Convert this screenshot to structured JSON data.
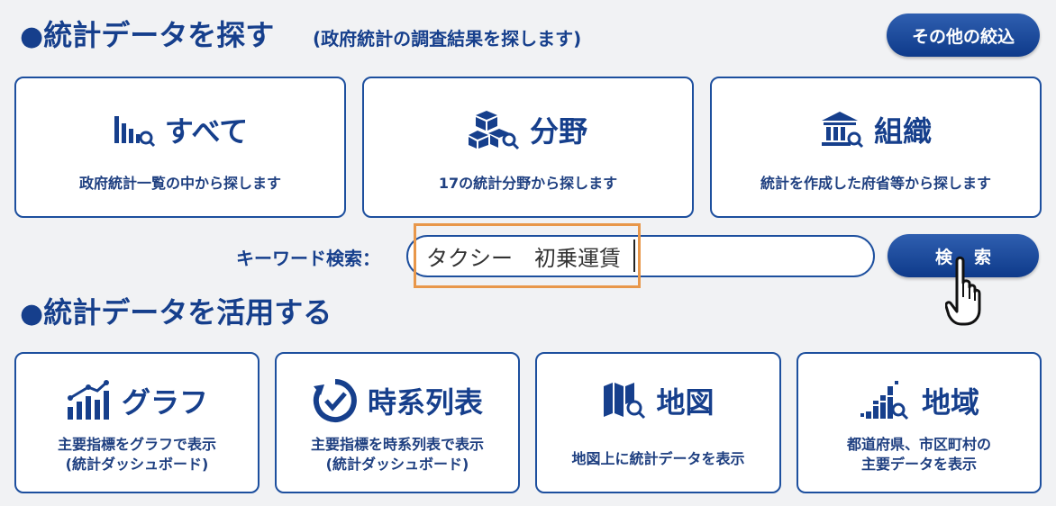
{
  "search_section": {
    "bullet": "●",
    "title": "統計データを探す",
    "subtitle": "(政府統計の調査結果を探します)",
    "other_filter_label": "その他の絞込"
  },
  "category_cards": [
    {
      "title": "すべて",
      "description": "政府統計一覧の中から探します",
      "icon": "bar-chart-search-icon"
    },
    {
      "title": "分野",
      "description": "17の統計分野から探します",
      "icon": "cubes-search-icon"
    },
    {
      "title": "組織",
      "description": "統計を作成した府省等から探します",
      "icon": "building-search-icon"
    }
  ],
  "keyword_search": {
    "label": "キーワード検索：",
    "value": "タクシー　初乗運賃",
    "button_label": "検索"
  },
  "use_section": {
    "bullet": "●",
    "title": "統計データを活用する"
  },
  "use_cards": [
    {
      "title": "グラフ",
      "description_line1": "主要指標をグラフで表示",
      "description_line2": "(統計ダッシュボード)",
      "icon": "graph-icon"
    },
    {
      "title": "時系列表",
      "description_line1": "主要指標を時系列表で表示",
      "description_line2": "(統計ダッシュボード)",
      "icon": "clock-check-icon"
    },
    {
      "title": "地図",
      "description_line1": "地図上に統計データを表示",
      "description_line2": "",
      "icon": "map-search-icon"
    },
    {
      "title": "地域",
      "description_line1": "都道府県、市区町村の",
      "description_line2": "主要データを表示",
      "icon": "region-bars-search-icon"
    }
  ],
  "colors": {
    "primary": "#163f8c",
    "button": "#0e3a8a",
    "highlight": "#e8974a",
    "background": "#f1f2f4"
  }
}
